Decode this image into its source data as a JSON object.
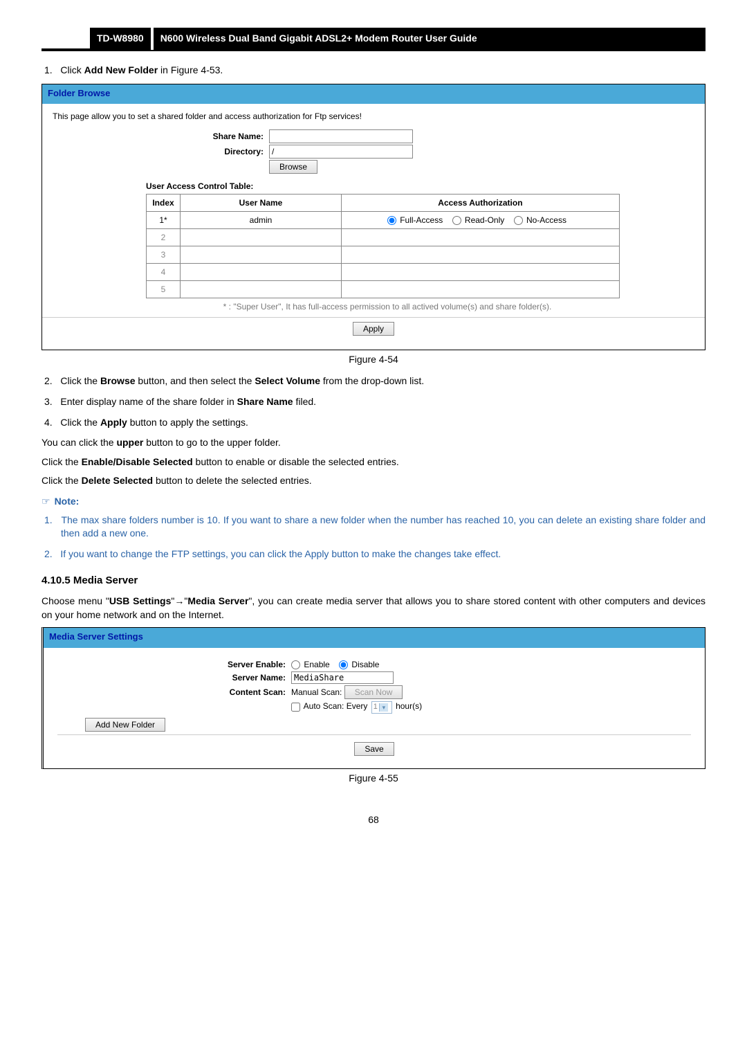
{
  "header": {
    "model": "TD-W8980",
    "title": "N600 Wireless Dual Band Gigabit ADSL2+ Modem Router User Guide"
  },
  "step1_pre": "Click ",
  "step1_bold": "Add New Folder",
  "step1_post": " in Figure 4-53.",
  "folderBrowse": {
    "header": "Folder Browse",
    "desc": "This page allow you to set a shared folder and access authorization for Ftp services!",
    "shareNameLabel": "Share Name:",
    "directoryLabel": "Directory:",
    "directoryValue": "/",
    "browseBtn": "Browse",
    "uactLabel": "User Access Control Table:",
    "cols": {
      "index": "Index",
      "user": "User Name",
      "access": "Access Authorization"
    },
    "row1": {
      "index": "1*",
      "user": "admin",
      "full": "Full-Access",
      "read": "Read-Only",
      "no": "No-Access"
    },
    "rows_empty": [
      "2",
      "3",
      "4",
      "5"
    ],
    "footnote": "* : \"Super User\", It has full-access permission to all actived volume(s) and share folder(s).",
    "apply": "Apply"
  },
  "fig54": "Figure 4-54",
  "step2": {
    "pre": "Click the ",
    "b1": "Browse",
    "mid": " button, and then select the ",
    "b2": "Select Volume",
    "post": " from the drop-down list."
  },
  "step3": {
    "pre": "Enter display name of the share folder in ",
    "b": "Share Name",
    "post": " filed."
  },
  "step4": {
    "pre": "Click the ",
    "b": "Apply",
    "post": " button to apply the settings."
  },
  "paraUpper": {
    "pre": "You can click the ",
    "b": "upper",
    "post": " button to go to the upper folder."
  },
  "paraEnable": {
    "pre": "Click the ",
    "b": "Enable/Disable Selected",
    "post": " button to enable or disable the selected entries."
  },
  "paraDelete": {
    "pre": "Click the ",
    "b": "Delete Selected",
    "post": " button to delete the selected entries."
  },
  "noteHead": "Note:",
  "note1": "The max share folders number is 10. If you want to share a new folder when the number has reached 10, you can delete an existing share folder and then add a new one.",
  "note2": "If you want to change the FTP settings, you can click the Apply button to make the changes take effect.",
  "subheading": "4.10.5 Media Server",
  "mediaPara": {
    "pre": "Choose menu \"",
    "b1": "USB Settings",
    "arrow": "\"→\"",
    "b2": "Media Server",
    "post": "\", you can create media server that allows you to share stored content with other computers and devices on your home network and on the Internet."
  },
  "media": {
    "header": "Media Server Settings",
    "serverEnableLabel": "Server Enable:",
    "enable": "Enable",
    "disable": "Disable",
    "serverNameLabel": "Server Name:",
    "serverNameValue": "MediaShare",
    "contentScanLabel": "Content Scan:",
    "manualScanLabel": "Manual Scan:",
    "scanNowBtn": "Scan Now",
    "autoScanPre": "Auto Scan: Every",
    "autoScanVal": "1",
    "autoScanPost": "hour(s)",
    "addNewFolderBtn": "Add New Folder",
    "saveBtn": "Save"
  },
  "fig55": "Figure 4-55",
  "pageNum": "68"
}
